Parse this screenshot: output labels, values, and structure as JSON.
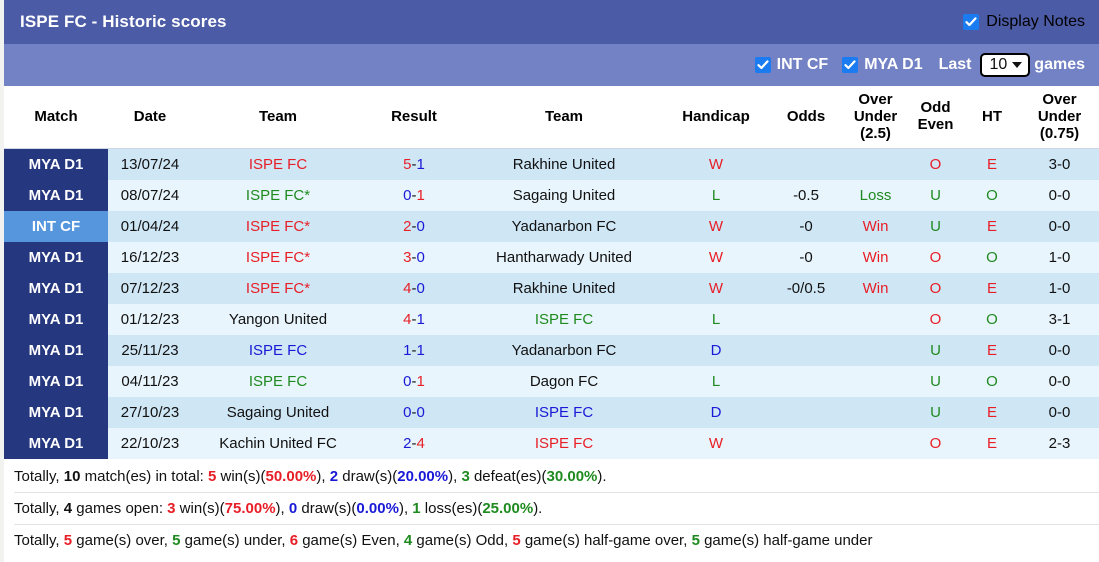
{
  "header": {
    "title": "ISPE FC - Historic scores",
    "display_notes_label": "Display Notes",
    "display_notes_checked": true
  },
  "filters": {
    "competitions": [
      {
        "label": "INT CF",
        "checked": true
      },
      {
        "label": "MYA D1",
        "checked": true
      }
    ],
    "last_label": "Last",
    "games_label": "games",
    "count_value": "10",
    "count_options": [
      "10",
      "20",
      "30",
      "50"
    ]
  },
  "colors": {
    "title_bar": "#4c5ba6",
    "filter_bar": "#7382c4",
    "league_badge": "#25377e",
    "cup_badge": "#5596dd",
    "row_even": "#cfe6f5",
    "row_odd": "#e8f5fc",
    "win": "#e81e26",
    "loss": "#1f8a1f",
    "draw": "#1a1ad6",
    "checkbox": "#1a7cf0"
  },
  "table": {
    "columns": [
      "Match",
      "Date",
      "Team",
      "Result",
      "Team",
      "Handicap",
      "Odds",
      "Over Under (2.5)",
      "Odd Even",
      "HT",
      "Over Under (0.75)"
    ],
    "columns_multiline": [
      [
        "Match"
      ],
      [
        "Date"
      ],
      [
        "Team"
      ],
      [
        "Result"
      ],
      [
        "Team"
      ],
      [
        "Handicap"
      ],
      [
        "Odds"
      ],
      [
        "Over",
        "Under",
        "(2.5)"
      ],
      [
        "Odd",
        "Even"
      ],
      [
        "HT"
      ],
      [
        "Over",
        "Under",
        "(0.75)"
      ]
    ],
    "rows": [
      {
        "match": "MYA D1",
        "match_type": "league",
        "date": "13/07/24",
        "home": "ISPE FC",
        "home_color": "win",
        "score_home": "5",
        "score_away": "1",
        "score_home_color": "win",
        "score_away_color": "draw",
        "away": "Rakhine United",
        "away_color": "dark",
        "wdl": "W",
        "wdl_color": "win",
        "handicap": "",
        "odds": "",
        "odds_color": "dark",
        "ou25": "O",
        "ou25_color": "win",
        "oddeven": "E",
        "oddeven_color": "win",
        "ht": "3-0",
        "ou075": "O",
        "ou075_color": "win"
      },
      {
        "match": "MYA D1",
        "match_type": "league",
        "date": "08/07/24",
        "home": "ISPE FC*",
        "home_color": "loss",
        "score_home": "0",
        "score_away": "1",
        "score_home_color": "draw",
        "score_away_color": "win",
        "away": "Sagaing United",
        "away_color": "dark",
        "wdl": "L",
        "wdl_color": "loss",
        "handicap": "-0.5",
        "odds": "Loss",
        "odds_color": "loss",
        "ou25": "U",
        "ou25_color": "loss",
        "oddeven": "O",
        "oddeven_color": "loss",
        "ht": "0-0",
        "ou075": "U",
        "ou075_color": "loss"
      },
      {
        "match": "INT CF",
        "match_type": "cup",
        "date": "01/04/24",
        "home": "ISPE FC*",
        "home_color": "win",
        "score_home": "2",
        "score_away": "0",
        "score_home_color": "win",
        "score_away_color": "draw",
        "away": "Yadanarbon FC",
        "away_color": "dark",
        "wdl": "W",
        "wdl_color": "win",
        "handicap": "-0",
        "odds": "Win",
        "odds_color": "win",
        "ou25": "U",
        "ou25_color": "loss",
        "oddeven": "E",
        "oddeven_color": "win",
        "ht": "0-0",
        "ou075": "U",
        "ou075_color": "loss"
      },
      {
        "match": "MYA D1",
        "match_type": "league",
        "date": "16/12/23",
        "home": "ISPE FC*",
        "home_color": "win",
        "score_home": "3",
        "score_away": "0",
        "score_home_color": "win",
        "score_away_color": "draw",
        "away": "Hantharwady United",
        "away_color": "dark",
        "wdl": "W",
        "wdl_color": "win",
        "handicap": "-0",
        "odds": "Win",
        "odds_color": "win",
        "ou25": "O",
        "ou25_color": "win",
        "oddeven": "O",
        "oddeven_color": "loss",
        "ht": "1-0",
        "ou075": "O",
        "ou075_color": "win"
      },
      {
        "match": "MYA D1",
        "match_type": "league",
        "date": "07/12/23",
        "home": "ISPE FC*",
        "home_color": "win",
        "score_home": "4",
        "score_away": "0",
        "score_home_color": "win",
        "score_away_color": "draw",
        "away": "Rakhine United",
        "away_color": "dark",
        "wdl": "W",
        "wdl_color": "win",
        "handicap": "-0/0.5",
        "odds": "Win",
        "odds_color": "win",
        "ou25": "O",
        "ou25_color": "win",
        "oddeven": "E",
        "oddeven_color": "win",
        "ht": "1-0",
        "ou075": "O",
        "ou075_color": "win"
      },
      {
        "match": "MYA D1",
        "match_type": "league",
        "date": "01/12/23",
        "home": "Yangon United",
        "home_color": "dark",
        "score_home": "4",
        "score_away": "1",
        "score_home_color": "win",
        "score_away_color": "draw",
        "away": "ISPE FC",
        "away_color": "loss",
        "wdl": "L",
        "wdl_color": "loss",
        "handicap": "",
        "odds": "",
        "odds_color": "dark",
        "ou25": "O",
        "ou25_color": "win",
        "oddeven": "O",
        "oddeven_color": "loss",
        "ht": "3-1",
        "ou075": "O",
        "ou075_color": "win"
      },
      {
        "match": "MYA D1",
        "match_type": "league",
        "date": "25/11/23",
        "home": "ISPE FC",
        "home_color": "draw",
        "score_home": "1",
        "score_away": "1",
        "score_home_color": "draw",
        "score_away_color": "draw",
        "away": "Yadanarbon FC",
        "away_color": "dark",
        "wdl": "D",
        "wdl_color": "draw",
        "handicap": "",
        "odds": "",
        "odds_color": "dark",
        "ou25": "U",
        "ou25_color": "loss",
        "oddeven": "E",
        "oddeven_color": "win",
        "ht": "0-0",
        "ou075": "U",
        "ou075_color": "loss"
      },
      {
        "match": "MYA D1",
        "match_type": "league",
        "date": "04/11/23",
        "home": "ISPE FC",
        "home_color": "loss",
        "score_home": "0",
        "score_away": "1",
        "score_home_color": "draw",
        "score_away_color": "win",
        "away": "Dagon FC",
        "away_color": "dark",
        "wdl": "L",
        "wdl_color": "loss",
        "handicap": "",
        "odds": "",
        "odds_color": "dark",
        "ou25": "U",
        "ou25_color": "loss",
        "oddeven": "O",
        "oddeven_color": "loss",
        "ht": "0-0",
        "ou075": "U",
        "ou075_color": "loss"
      },
      {
        "match": "MYA D1",
        "match_type": "league",
        "date": "27/10/23",
        "home": "Sagaing United",
        "home_color": "dark",
        "score_home": "0",
        "score_away": "0",
        "score_home_color": "draw",
        "score_away_color": "draw",
        "away": "ISPE FC",
        "away_color": "draw",
        "wdl": "D",
        "wdl_color": "draw",
        "handicap": "",
        "odds": "",
        "odds_color": "dark",
        "ou25": "U",
        "ou25_color": "loss",
        "oddeven": "E",
        "oddeven_color": "win",
        "ht": "0-0",
        "ou075": "U",
        "ou075_color": "loss"
      },
      {
        "match": "MYA D1",
        "match_type": "league",
        "date": "22/10/23",
        "home": "Kachin United FC",
        "home_color": "dark",
        "score_home": "2",
        "score_away": "4",
        "score_home_color": "draw",
        "score_away_color": "win",
        "away": "ISPE FC",
        "away_color": "win",
        "wdl": "W",
        "wdl_color": "win",
        "handicap": "",
        "odds": "",
        "odds_color": "dark",
        "ou25": "O",
        "ou25_color": "win",
        "oddeven": "E",
        "oddeven_color": "win",
        "ht": "2-3",
        "ou075": "O",
        "ou075_color": "win"
      }
    ]
  },
  "summary": {
    "line1": {
      "t1": "Totally, ",
      "matches": "10",
      "t2": " match(es) in total: ",
      "wins": "5",
      "t3": " win(s)(",
      "win_pct": "50.00%",
      "t4": "), ",
      "draws": "2",
      "t5": " draw(s)(",
      "draw_pct": "20.00%",
      "t6": "), ",
      "defeats": "3",
      "t7": " defeat(es)(",
      "defeat_pct": "30.00%",
      "t8": ")."
    },
    "line2": {
      "t1": "Totally, ",
      "games": "4",
      "t2": " games open: ",
      "wins": "3",
      "t3": " win(s)(",
      "win_pct": "75.00%",
      "t4": "), ",
      "draws": "0",
      "t5": " draw(s)(",
      "draw_pct": "0.00%",
      "t6": "), ",
      "losses": "1",
      "t7": " loss(es)(",
      "loss_pct": "25.00%",
      "t8": ")."
    },
    "line3": {
      "t1": "Totally, ",
      "over": "5",
      "t2": " game(s) over, ",
      "under": "5",
      "t3": " game(s) under, ",
      "even": "6",
      "t4": " game(s) Even, ",
      "odd": "4",
      "t5": " game(s) Odd, ",
      "half_over": "5",
      "t6": " game(s) half-game over, ",
      "half_under": "5",
      "t7": " game(s) half-game under"
    }
  }
}
